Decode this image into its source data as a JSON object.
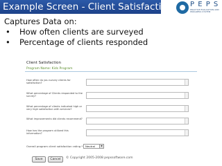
{
  "slide": {
    "title": "Example Screen - Client Satisfaction",
    "intro": "Captures Data on:",
    "bullets": [
      "How often clients are surveyed",
      "Percentage of clients responded"
    ]
  },
  "logo": {
    "text": "P E P S",
    "tagline": "PRACTICE EVALUATION AND PROGRESS SYSTEM"
  },
  "form": {
    "title": "Client Satisfaction",
    "program": "Program Name: Kids Program",
    "questions": [
      "How often do you survey clients for satisfaction?",
      "What percentage of Clients responded to the survey?",
      "What percentage of clients indicated high or very high satisfaction with services?",
      "What improvements did clients recommend?",
      "How has the program utilized this information?"
    ],
    "overall_label": "Overall program client satisfaction rating *",
    "overall_value": "Neutral",
    "save_label": "Save",
    "cancel_label": "Cancel"
  },
  "footer": {
    "copyright": "© Copyright 2005-2008 pepssoftware.com"
  }
}
